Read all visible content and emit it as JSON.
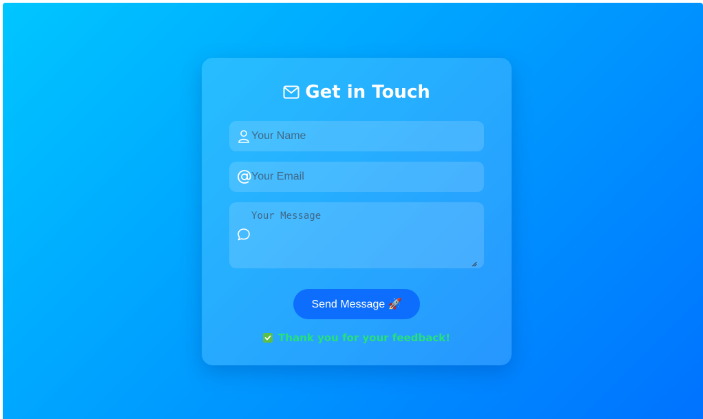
{
  "form": {
    "title": "Get in Touch",
    "title_icon": "envelope-icon",
    "name_placeholder": "Your Name",
    "name_icon": "user-icon",
    "email_placeholder": "Your Email",
    "email_icon": "at-sign-icon",
    "message_placeholder": "Your Message",
    "message_icon": "chat-bubble-icon",
    "submit_label": "Send Message 🚀",
    "feedback_text": "Thank you for your feedback!",
    "feedback_icon": "check-icon"
  },
  "colors": {
    "background_start": "#00c6ff",
    "background_end": "#0072ff",
    "button": "#0d6efd",
    "success": "#27e07a"
  }
}
